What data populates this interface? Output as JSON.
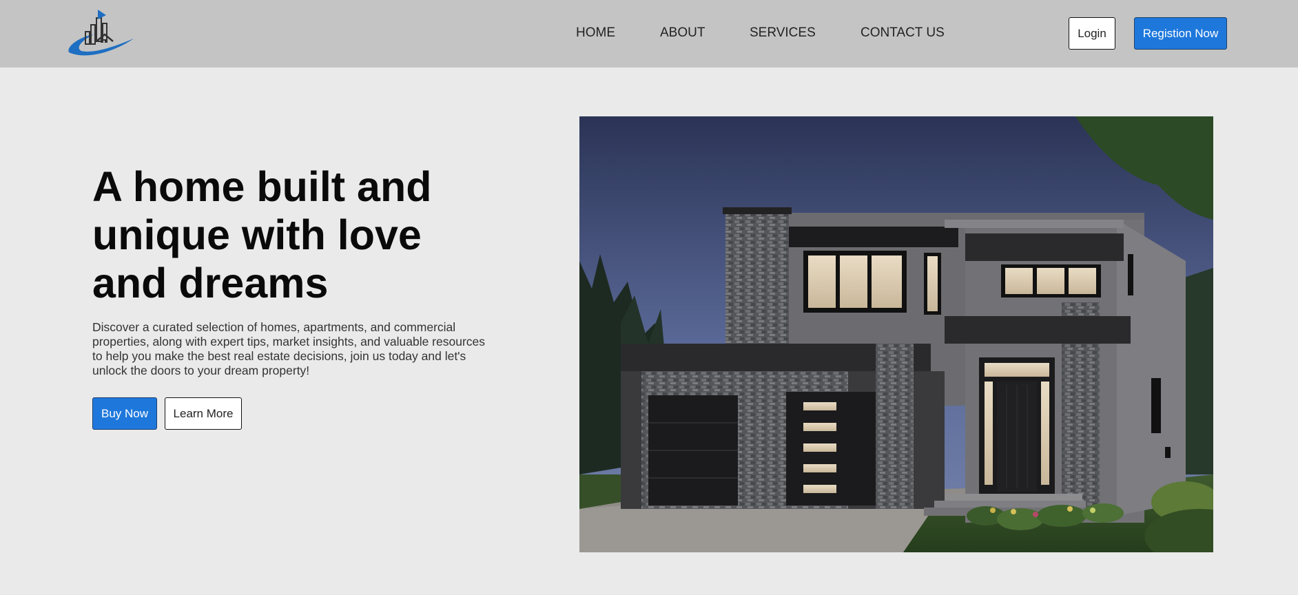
{
  "nav": {
    "links": [
      "HOME",
      "ABOUT",
      "SERVICES",
      "CONTACT US"
    ],
    "login_label": "Login",
    "register_label": "Registion Now"
  },
  "hero": {
    "title_lines": [
      "A home built and",
      "unique with love",
      "and dreams"
    ],
    "description": "Discover a curated selection of homes, apartments, and commercial properties, along with expert tips, market insights, and valuable resources to help you make the best real estate decisions, join us today and let's unlock the doors to your dream property!",
    "buy_label": "Buy Now",
    "learn_label": "Learn More"
  },
  "colors": {
    "accent": "#1e78dc",
    "navbar": "#c4c4c4",
    "page_bg": "#eaeaea"
  },
  "icons": {
    "logo": "house-city-swoosh-logo"
  }
}
